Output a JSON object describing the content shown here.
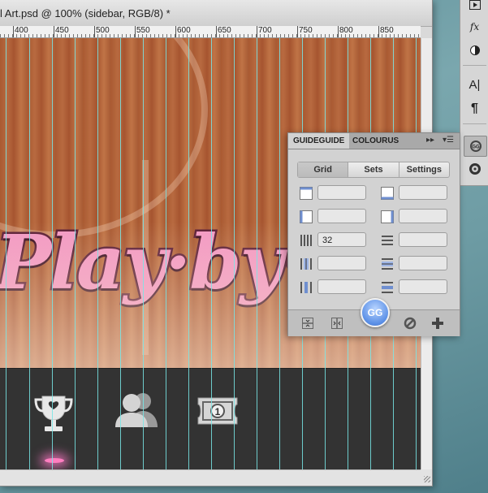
{
  "document": {
    "title": "l Art.psd @ 100% (sidebar, RGB/8) *",
    "ruler_labels": [
      "400",
      "450",
      "500",
      "550",
      "600",
      "650",
      "700",
      "750",
      "800",
      "850"
    ],
    "logo_text": "Play·by·Pl"
  },
  "tool_strip": {
    "icons": [
      "play-icon",
      "fx-icon",
      "layer-mask-icon",
      "character-icon",
      "paragraph-icon",
      "guideguide-icon",
      "cd-icon"
    ]
  },
  "panel": {
    "tabs": [
      {
        "label": "GUIDEGUIDE",
        "active": true
      },
      {
        "label": "COLOURUS",
        "active": false
      }
    ],
    "menu_arrows": "▸▸",
    "menu_icon": "▾☰",
    "segments": [
      {
        "label": "Grid",
        "active": true
      },
      {
        "label": "Sets",
        "active": false
      },
      {
        "label": "Settings",
        "active": false
      }
    ],
    "fields": {
      "left_margin": "",
      "right_margin": "",
      "left_margin_2": "",
      "right_margin_2": "",
      "columns": "32",
      "rows": "",
      "column_midpoint": "",
      "row_midpoint": "",
      "column_gutter": "",
      "row_gutter": ""
    },
    "gg_label": "GG"
  },
  "colors": {
    "guide": "#78e6e6",
    "logo_fill": "#f39ac4",
    "panel_bg": "#d2d2d2",
    "gg_blue": "#5a8fe6"
  }
}
